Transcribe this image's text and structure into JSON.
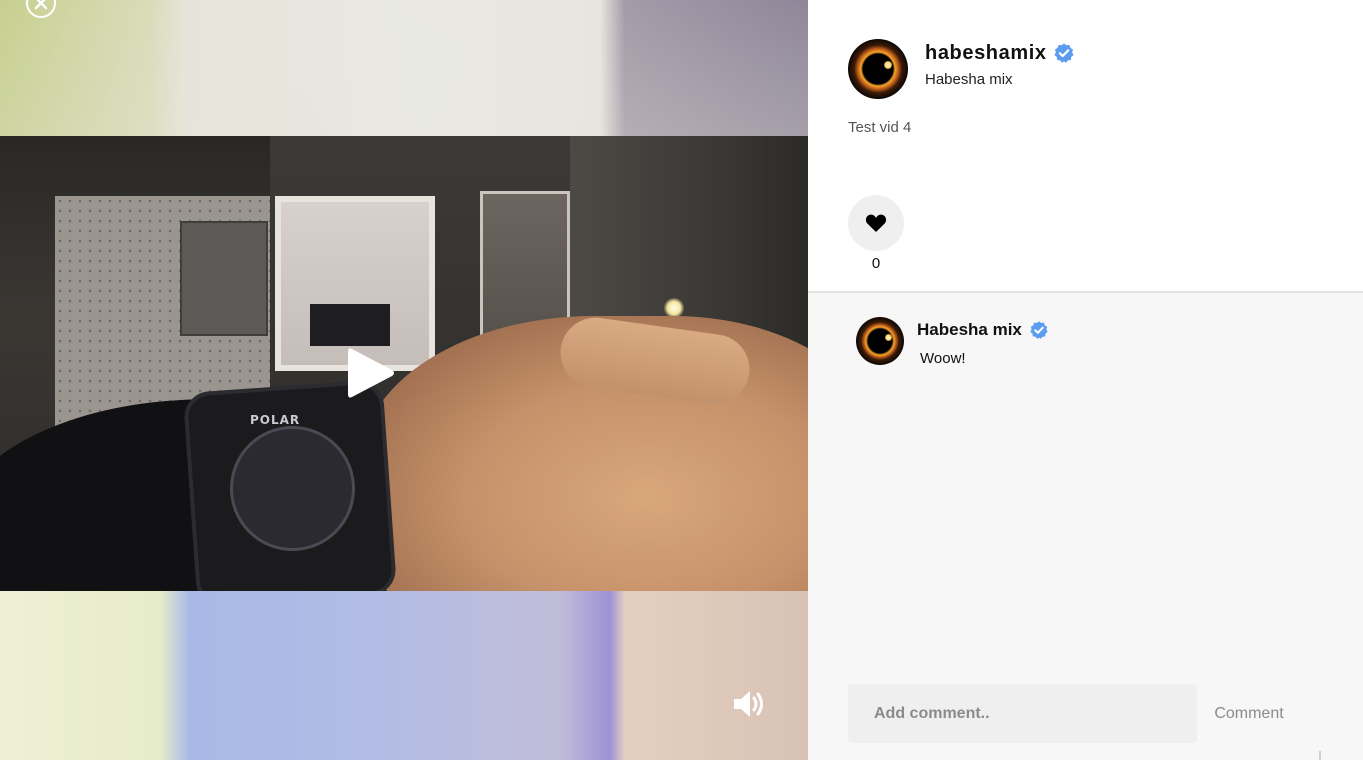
{
  "viewer": {
    "close_icon": "close-circle-icon",
    "play_icon": "play-icon",
    "sound_icon": "volume-icon",
    "watch_brand": "POLAR"
  },
  "post": {
    "username": "habeshamix",
    "display_name": "Habesha mix",
    "verified": true,
    "caption": "Test vid 4",
    "likes": "0",
    "like_icon": "heart-icon"
  },
  "comments": [
    {
      "author": "Habesha mix",
      "verified": true,
      "text": "Woow!"
    }
  ],
  "comment_form": {
    "placeholder": "Add comment..",
    "submit_label": "Comment"
  },
  "colors": {
    "verified_badge": "#5b9cf0",
    "panel_bg": "#ffffff",
    "comments_bg": "#f7f7f7",
    "input_bg": "#efefef",
    "muted_text": "#8b8b8b"
  }
}
